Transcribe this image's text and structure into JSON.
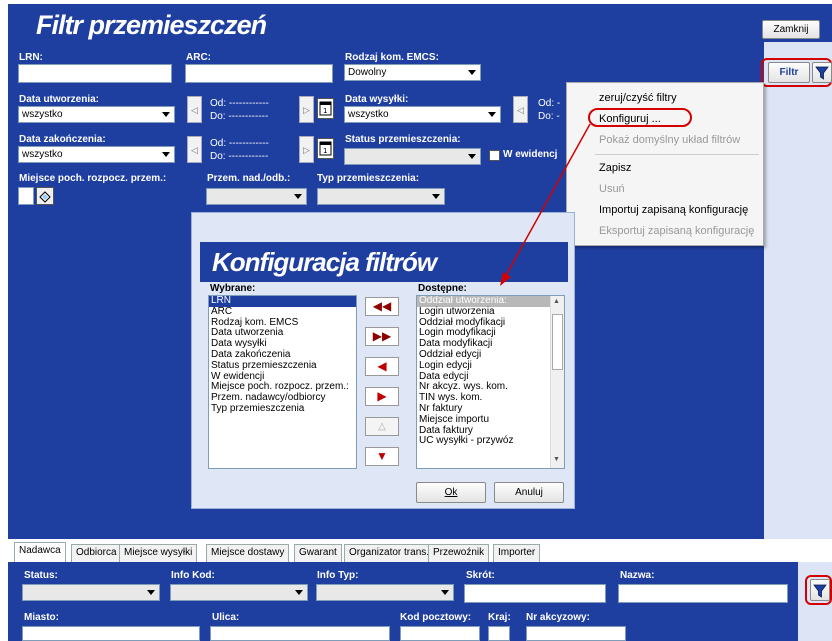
{
  "window": {
    "title": "Filtr przemieszczeń",
    "close_label": "Zamknij"
  },
  "filters": {
    "lrn_label": "LRN:",
    "arc_label": "ARC:",
    "rodzaj_label": "Rodzaj kom. EMCS:",
    "rodzaj_value": "Dowolny",
    "data_utw_label": "Data utworzenia:",
    "data_utw_value": "wszystko",
    "data_wys_label": "Data wysyłki:",
    "data_wys_value": "wszystko",
    "data_zak_label": "Data zakończenia:",
    "data_zak_value": "wszystko",
    "status_label": "Status przemieszczenia:",
    "status_value": "",
    "w_ewidencji_label": "W ewidencj",
    "od_label": "Od:",
    "do_label": "Do:",
    "od_value": "------------",
    "do_value": "------------",
    "miejsce_label": "Miejsce poch. rozpocz. przem.:",
    "przem_label": "Przem. nad./odb.:",
    "typ_label": "Typ przemieszczenia:",
    "od_short": "Od: -",
    "do_short": "Do: -"
  },
  "filter_button": {
    "label": "Filtr"
  },
  "context_menu": {
    "items": [
      {
        "label": "zeruj/czyść filtry",
        "enabled": true
      },
      {
        "label": "Konfiguruj ...",
        "enabled": true,
        "highlighted": true
      },
      {
        "label": "Pokaż domyślny układ filtrów",
        "enabled": false
      },
      {
        "label": "Zapisz",
        "enabled": true
      },
      {
        "label": "Usuń",
        "enabled": false
      },
      {
        "label": "Importuj zapisaną konfigurację",
        "enabled": true
      },
      {
        "label": "Eksportuj zapisaną konfigurację",
        "enabled": false
      }
    ]
  },
  "dialog": {
    "title": "Konfiguracja filtrów",
    "selected_label": "Wybrane:",
    "available_label": "Dostępne:",
    "selected_items": [
      "LRN",
      "ARC",
      "Rodzaj kom. EMCS",
      "Data utworzenia",
      "Data wysyłki",
      "Data zakończenia",
      "Status przemieszczenia",
      "W ewidencji",
      "Miejsce poch. rozpocz. przem.:",
      "Przem. nadawcy/odbiorcy",
      "Typ przemieszczenia"
    ],
    "available_items": [
      "Oddział utworzenia:",
      "Login utworzenia",
      "Oddział modyfikacji",
      "Login modyfikacji",
      "Data modyfikacji",
      "Oddział edycji",
      "Login edycji",
      "Data edycji",
      "Nr akcyz. wys. kom.",
      "TIN wys. kom.",
      "Nr faktury",
      "Miejsce importu",
      "Data faktury",
      "UC wysyłki - przywóz"
    ],
    "ok_label": "Ok",
    "cancel_label": "Anuluj"
  },
  "tabs": [
    "Nadawca",
    "Odbiorca",
    "Miejsce wysyłki",
    "Miejsce dostawy",
    "Gwarant",
    "Organizator trans.",
    "Przewoźnik",
    "Importer"
  ],
  "bottom": {
    "status_label": "Status:",
    "info_kod_label": "Info Kod:",
    "info_typ_label": "Info Typ:",
    "skrot_label": "Skrót:",
    "nazwa_label": "Nazwa:",
    "miasto_label": "Miasto:",
    "ulica_label": "Ulica:",
    "kod_label": "Kod pocztowy:",
    "kraj_label": "Kraj:",
    "nr_akc_label": "Nr akcyzowy:"
  },
  "colors": {
    "primary": "#1f3fa0",
    "accent_red": "#d40000"
  }
}
